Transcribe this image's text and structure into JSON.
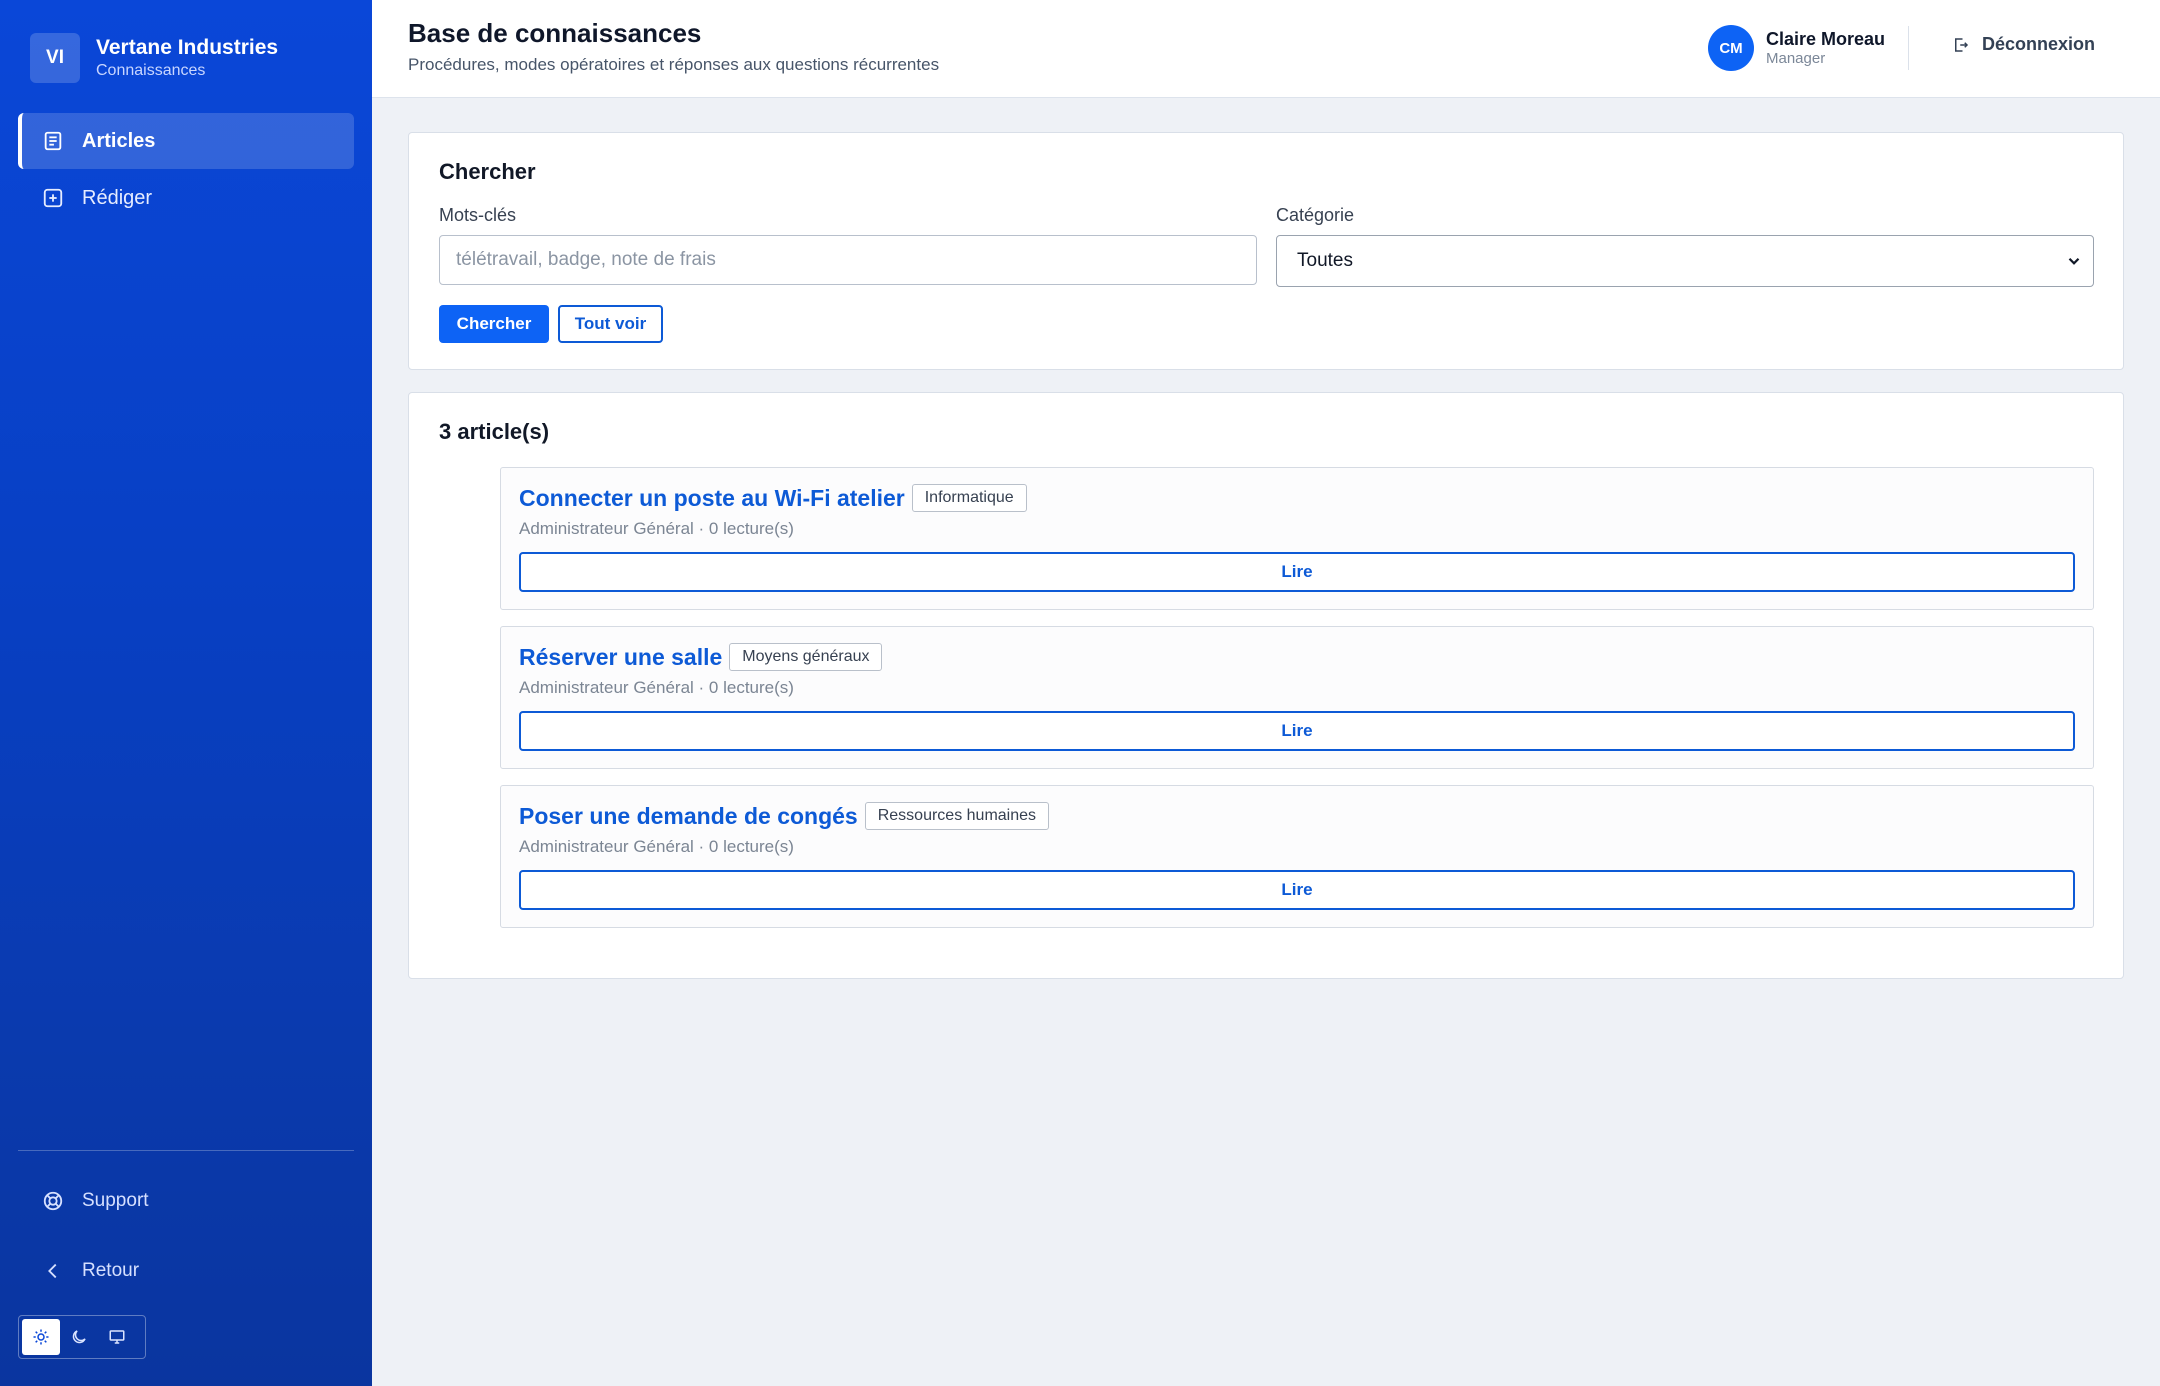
{
  "brand": {
    "initials": "VI",
    "name": "Vertane Industries",
    "subtitle": "Connaissances"
  },
  "sidebar": {
    "items": [
      {
        "label": "Articles",
        "icon": "document-icon",
        "active": true
      },
      {
        "label": "Rédiger",
        "icon": "plus-square-icon",
        "active": false
      }
    ],
    "footer": [
      {
        "label": "Support",
        "icon": "lifebuoy-icon"
      },
      {
        "label": "Retour",
        "icon": "chevron-left-icon"
      }
    ],
    "theme": {
      "options": [
        "light",
        "dark",
        "system"
      ],
      "selected": "light"
    }
  },
  "header": {
    "title": "Base de connaissances",
    "subtitle": "Procédures, modes opératoires et réponses aux questions récurrentes",
    "user": {
      "initials": "CM",
      "name": "Claire Moreau",
      "role": "Manager"
    },
    "logout_label": "Déconnexion"
  },
  "search": {
    "title": "Chercher",
    "keywords_label": "Mots-clés",
    "keywords_placeholder": "télétravail, badge, note de frais",
    "keywords_value": "",
    "category_label": "Catégorie",
    "category_value": "Toutes",
    "submit_label": "Chercher",
    "reset_label": "Tout voir"
  },
  "results": {
    "count_label": "3 article(s)",
    "articles": [
      {
        "title": "Connecter un poste au Wi-Fi atelier",
        "category": "Informatique",
        "meta": "Administrateur Général · 0 lecture(s)",
        "read_label": "Lire"
      },
      {
        "title": "Réserver une salle",
        "category": "Moyens généraux",
        "meta": "Administrateur Général · 0 lecture(s)",
        "read_label": "Lire"
      },
      {
        "title": "Poser une demande de congés",
        "category": "Ressources humaines",
        "meta": "Administrateur Général · 0 lecture(s)",
        "read_label": "Lire"
      }
    ]
  },
  "colors": {
    "primary": "#0d63f5",
    "link": "#0d5ad6",
    "sidebar": "#0a47d8",
    "background": "#eef1f6"
  }
}
